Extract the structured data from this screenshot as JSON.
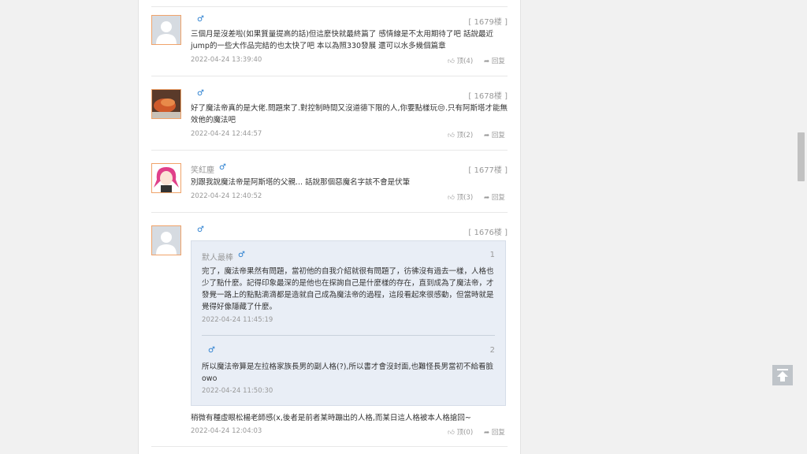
{
  "comments": [
    {
      "username": "",
      "floor": "[ 1679楼 ]",
      "text": "三個月是沒差啦(如果質量提高的話)但這麼快就最終篇了 感情線是不太用期待了吧 話說最近jump的一些大作品完結的也太快了吧 本以為照330發展 還可以水多幾個篇章",
      "date": "2022-04-24 13:39:40",
      "like": "顶(4)",
      "reply": "回复"
    },
    {
      "username": "",
      "floor": "[ 1678楼 ]",
      "text": "好了魔法帝真的是大佬.問題來了.對控制時間又沒道德下限的人,你要點樣玩😒.只有阿斯塔才能無效他的魔法吧",
      "date": "2022-04-24 12:44:57",
      "like": "顶(2)",
      "reply": "回复"
    },
    {
      "username": "笑紅塵",
      "floor": "[ 1677楼 ]",
      "text": "別跟我說魔法帝是阿斯塔的父親... 話說那個惡魔名字該不會是伏筆",
      "date": "2022-04-24 12:40:52",
      "like": "顶(3)",
      "reply": "回复"
    },
    {
      "username": "",
      "floor": "[ 1676楼 ]",
      "text": "稍微有種虛眼松楊老師感(x,後者是前者某時蹦出的人格,而某日這人格被本人格搶回~",
      "date": "2022-04-24 12:04:03",
      "like": "顶(0)",
      "reply": "回复",
      "quotes": [
        {
          "username": "默人最棒",
          "index": "1",
          "text": "完了，魔法帝果然有問題，當初他的自我介紹就很有問題了，彷彿沒有過去一樣，人格也少了點什麼。記得印象最深的是他也在探詢自己是什麼樣的存在，直到成為了魔法帝，才發覺一路上的點點滴滴都是造就自己成為魔法帝的過程，這段看起來很感動，但當時就是覺得好像隱藏了什麼。",
          "date": "2022-04-24 11:45:19"
        },
        {
          "username": "",
          "index": "2",
          "text": "所以魔法帝算是左拉格家族長男的副人格(?),所以書才會沒封面,也難怪長男當初不給看臉owo",
          "date": "2022-04-24 11:50:30"
        }
      ]
    }
  ],
  "icons": {
    "male": "♂",
    "like": "thumb-up-icon",
    "reply": "share-arrow-icon",
    "back_top": "back-to-top-icon"
  },
  "colors": {
    "male": "#2a7fd0",
    "avatar_border": "#f0a36a",
    "quote_bg": "#e9eef6"
  }
}
